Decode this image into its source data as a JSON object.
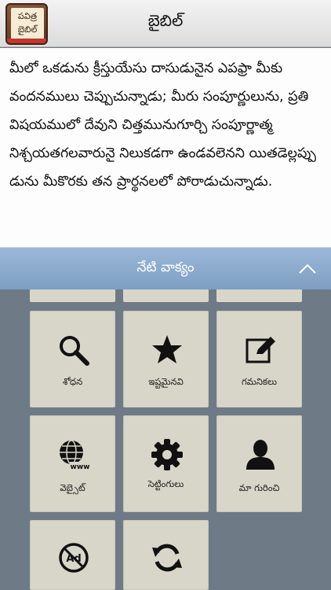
{
  "header": {
    "logo_line1": "పవిత్ర",
    "logo_line2": "బైబిల్",
    "title": "బైబిల్"
  },
  "verse": {
    "text": "మీలో ఒకడును క్రీస్తుయేసు దాసుడునైన ఎపఫ్రా మీకు వందనములు చెప్పుచున్నాడు; మీరు సంపూర్ణులును, ప్రతి విషయములో దేవుని చిత్తమునుగూర్చి సంపూర్ణాత్మ నిశ్చయతగలవారునై నిలుకడగా ఉండవలెనని యితడెల్లప్పు డును మీకొరకు తన ప్రార్థనలలో పోరాడుచున్నాడు."
  },
  "bar": {
    "label": "నేటి వాక్యం"
  },
  "menu": {
    "search": "శోధన",
    "favorites": "ఇష్టమైనవి",
    "notes": "గమనికలు",
    "website": "వెబ్సైట్",
    "settings": "సెట్టింగులు",
    "about": "మా గురించి"
  },
  "icons": [
    "search-icon",
    "star-icon",
    "edit-icon",
    "web-icon",
    "gear-icon",
    "person-icon",
    "no-ads-icon",
    "refresh-icon",
    "chevron-up-icon"
  ],
  "colors": {
    "tile": "#d8d6c9",
    "background": "#6e7a86",
    "bar": "#8eacd0"
  }
}
